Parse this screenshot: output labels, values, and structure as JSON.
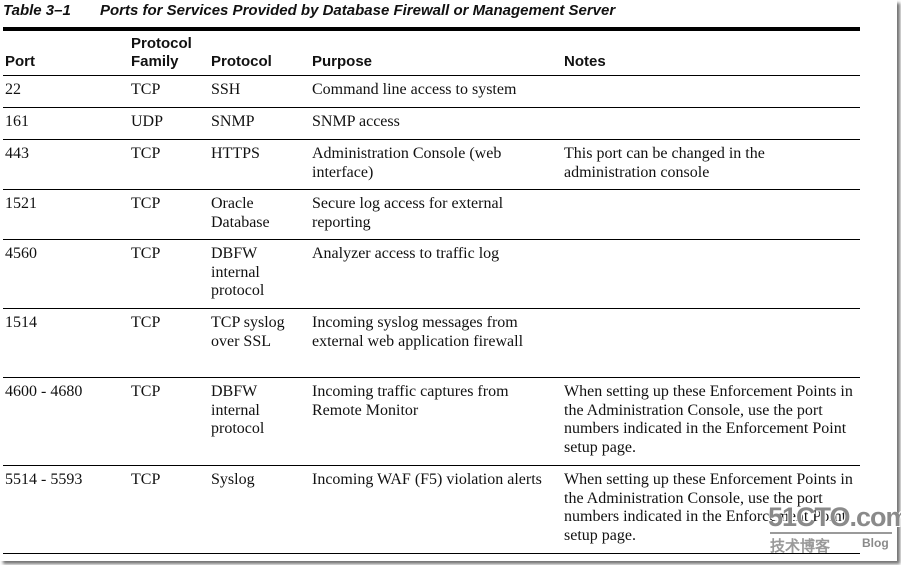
{
  "caption": {
    "number": "Table 3–1",
    "title": "Ports for Services Provided by Database Firewall or Management Server"
  },
  "headers": [
    "Port",
    "Protocol Family",
    "Protocol",
    "Purpose",
    "Notes"
  ],
  "rows": [
    {
      "port": "22",
      "family": "TCP",
      "protocol": "SSH",
      "purpose": "Command line access to system",
      "notes": ""
    },
    {
      "port": "161",
      "family": "UDP",
      "protocol": "SNMP",
      "purpose": "SNMP access",
      "notes": ""
    },
    {
      "port": "443",
      "family": "TCP",
      "protocol": "HTTPS",
      "purpose": "Administration Console (web interface)",
      "notes": "This port can be changed in the administration console"
    },
    {
      "port": "1521",
      "family": "TCP",
      "protocol": "Oracle Database",
      "purpose": "Secure log access for external reporting",
      "notes": ""
    },
    {
      "port": "4560",
      "family": "TCP",
      "protocol": "DBFW internal protocol",
      "purpose": "Analyzer access to traffic log",
      "notes": ""
    },
    {
      "port": "1514",
      "family": "TCP",
      "protocol": "TCP syslog over SSL",
      "purpose": "Incoming syslog messages from external web application firewall",
      "notes": ""
    },
    {
      "port": "4600 - 4680",
      "family": "TCP",
      "protocol": "DBFW internal protocol",
      "purpose": "Incoming traffic captures from Remote Monitor",
      "notes": "When setting up these Enforcement Points in the Administration Console, use the port numbers indicated in the Enforcement Point setup page."
    },
    {
      "port": "5514 - 5593",
      "family": "TCP",
      "protocol": "Syslog",
      "purpose": "Incoming WAF (F5) violation alerts",
      "notes": "When setting up these Enforcement Points in the Administration Console, use the port numbers indicated in the Enforcement Point setup page."
    }
  ],
  "watermark": {
    "main": "51CTO.com",
    "sub": "技术博客",
    "blog": "Blog"
  }
}
